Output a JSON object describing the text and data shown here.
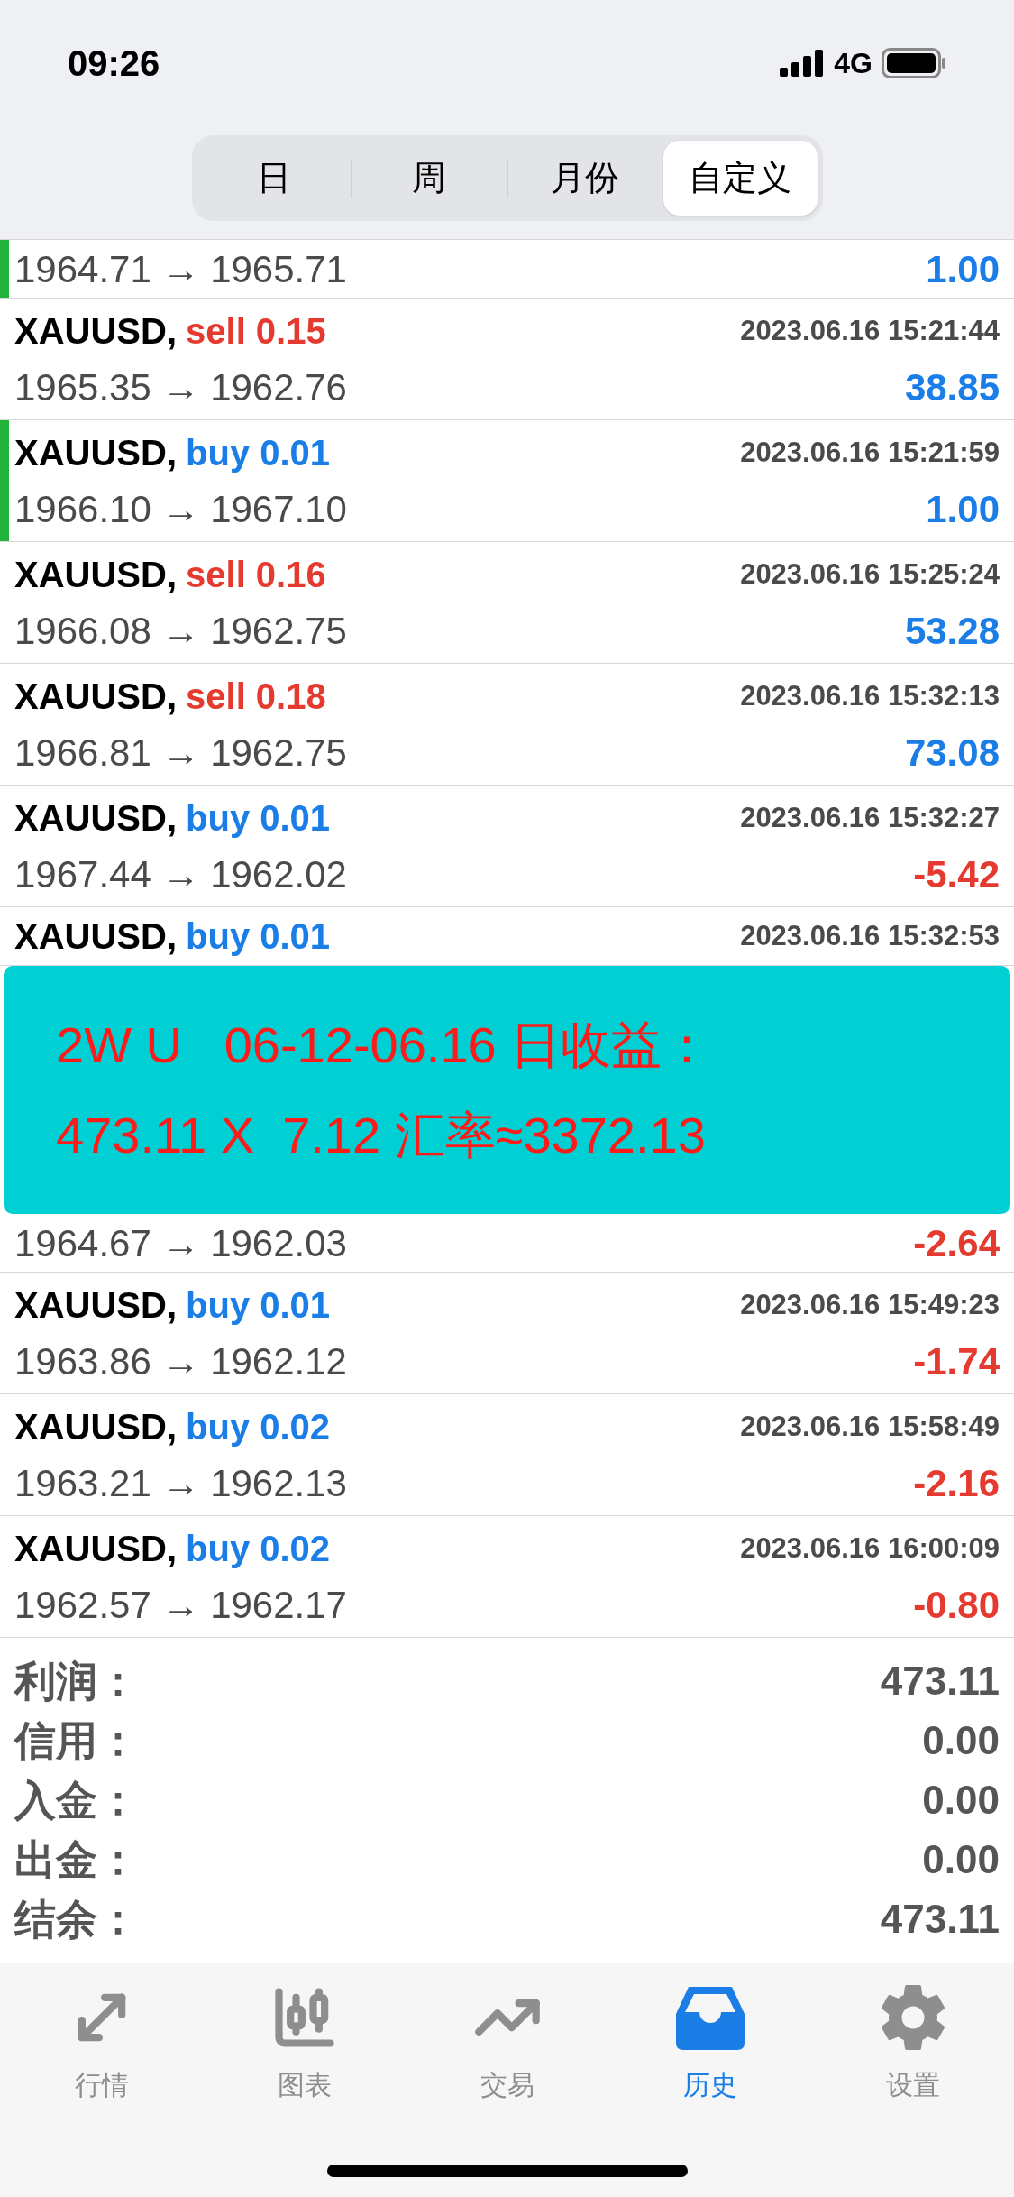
{
  "status_bar": {
    "time": "09:26",
    "network": "4G"
  },
  "segments": [
    {
      "label": "日",
      "selected": false
    },
    {
      "label": "周",
      "selected": false
    },
    {
      "label": "月份",
      "selected": false
    },
    {
      "label": "自定义",
      "selected": true
    }
  ],
  "deals": [
    {
      "flagged": true,
      "prices": "1964.71 → 1965.71",
      "profit": "1.00",
      "loss": false
    },
    {
      "flagged": false,
      "symbol": "XAUUSD,",
      "side": "sell 0.15",
      "color": "#e53a2f",
      "time": "2023.06.16 15:21:44",
      "prices": "1965.35 → 1962.76",
      "profit": "38.85",
      "loss": false
    },
    {
      "flagged": true,
      "symbol": "XAUUSD,",
      "side": "buy 0.01",
      "color": "#1a7ee6",
      "time": "2023.06.16 15:21:59",
      "prices": "1966.10 → 1967.10",
      "profit": "1.00",
      "loss": false
    },
    {
      "flagged": false,
      "symbol": "XAUUSD,",
      "side": "sell 0.16",
      "color": "#e53a2f",
      "time": "2023.06.16 15:25:24",
      "prices": "1966.08 → 1962.75",
      "profit": "53.28",
      "loss": false
    },
    {
      "flagged": false,
      "symbol": "XAUUSD,",
      "side": "sell 0.18",
      "color": "#e53a2f",
      "time": "2023.06.16 15:32:13",
      "prices": "1966.81 → 1962.75",
      "profit": "73.08",
      "loss": false
    },
    {
      "flagged": false,
      "symbol": "XAUUSD,",
      "side": "buy 0.01",
      "color": "#1a7ee6",
      "time": "2023.06.16 15:32:27",
      "prices": "1967.44 → 1962.02",
      "profit": "-5.42",
      "loss": true
    },
    {
      "flagged": false,
      "symbol": "XAUUSD,",
      "side": "buy 0.01",
      "color": "#1a7ee6",
      "time": "2023.06.16 15:32:53"
    }
  ],
  "banner": {
    "lines": [
      "2W U   06-12-06.16 日收益：",
      "473.11 X  7.12 汇率≈3372.13"
    ]
  },
  "deals_after": [
    {
      "flagged": false,
      "prices": "1964.67 → 1962.03",
      "profit": "-2.64",
      "loss": true
    },
    {
      "flagged": false,
      "symbol": "XAUUSD,",
      "side": "buy 0.01",
      "color": "#1a7ee6",
      "time": "2023.06.16 15:49:23",
      "prices": "1963.86 → 1962.12",
      "profit": "-1.74",
      "loss": true
    },
    {
      "flagged": false,
      "symbol": "XAUUSD,",
      "side": "buy 0.02",
      "color": "#1a7ee6",
      "time": "2023.06.16 15:58:49",
      "prices": "1963.21 → 1962.13",
      "profit": "-2.16",
      "loss": true
    },
    {
      "flagged": false,
      "symbol": "XAUUSD,",
      "side": "buy 0.02",
      "color": "#1a7ee6",
      "time": "2023.06.16 16:00:09",
      "prices": "1962.57 → 1962.17",
      "profit": "-0.80",
      "loss": true
    }
  ],
  "summary": [
    {
      "label": "利润：",
      "value": "473.11"
    },
    {
      "label": "信用：",
      "value": "0.00"
    },
    {
      "label": "入金：",
      "value": "0.00"
    },
    {
      "label": "出金：",
      "value": "0.00"
    },
    {
      "label": "结余：",
      "value": "473.11"
    }
  ],
  "tab_bar": [
    {
      "kind": "quotes",
      "label": "行情",
      "selected": false
    },
    {
      "kind": "chart",
      "label": "图表",
      "selected": false
    },
    {
      "kind": "trade",
      "label": "交易",
      "selected": false
    },
    {
      "kind": "history",
      "label": "历史",
      "selected": true
    },
    {
      "kind": "settings",
      "label": "设置",
      "selected": false
    }
  ]
}
